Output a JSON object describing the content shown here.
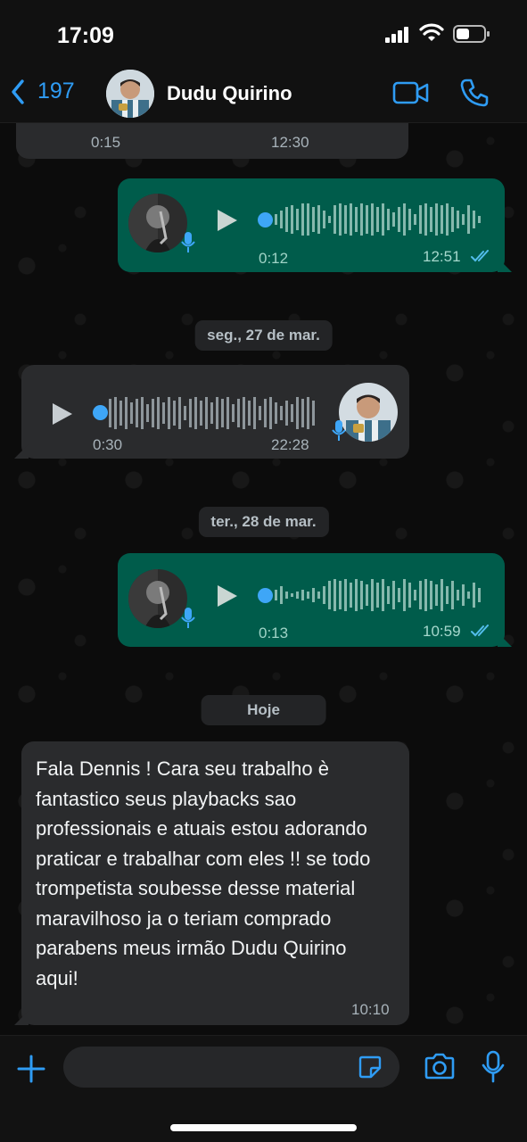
{
  "status_bar": {
    "time": "17:09"
  },
  "header": {
    "back_count": "197",
    "contact_name": "Dudu Quirino"
  },
  "messages": [
    {
      "kind": "audio",
      "dir": "in",
      "duration": "0:15",
      "time": "12:30"
    },
    {
      "kind": "audio",
      "dir": "out",
      "duration": "0:12",
      "time": "12:51"
    },
    {
      "kind": "date",
      "label": "seg., 27 de mar."
    },
    {
      "kind": "audio",
      "dir": "in",
      "duration": "0:30",
      "time": "22:28"
    },
    {
      "kind": "date",
      "label": "ter., 28 de mar."
    },
    {
      "kind": "audio",
      "dir": "out",
      "duration": "0:13",
      "time": "10:59"
    },
    {
      "kind": "date",
      "label": "Hoje"
    },
    {
      "kind": "text",
      "dir": "in",
      "time": "10:10",
      "text": "Fala Dennis ! Cara seu trabalho è fantastico seus playbacks sao professionais e atuais estou adorando praticar e trabalhar com eles !! se todo trompetista soubesse desse material maravilhoso ja o teriam comprado parabens meus irmão Dudu Quirino aqui!"
    }
  ],
  "composer": {
    "placeholder": ""
  },
  "colors": {
    "accent": "#2f9cf4",
    "outgoing_bubble": "#005c4b",
    "incoming_bubble": "#2a2b2d",
    "read_ticks": "#53bdeb"
  }
}
